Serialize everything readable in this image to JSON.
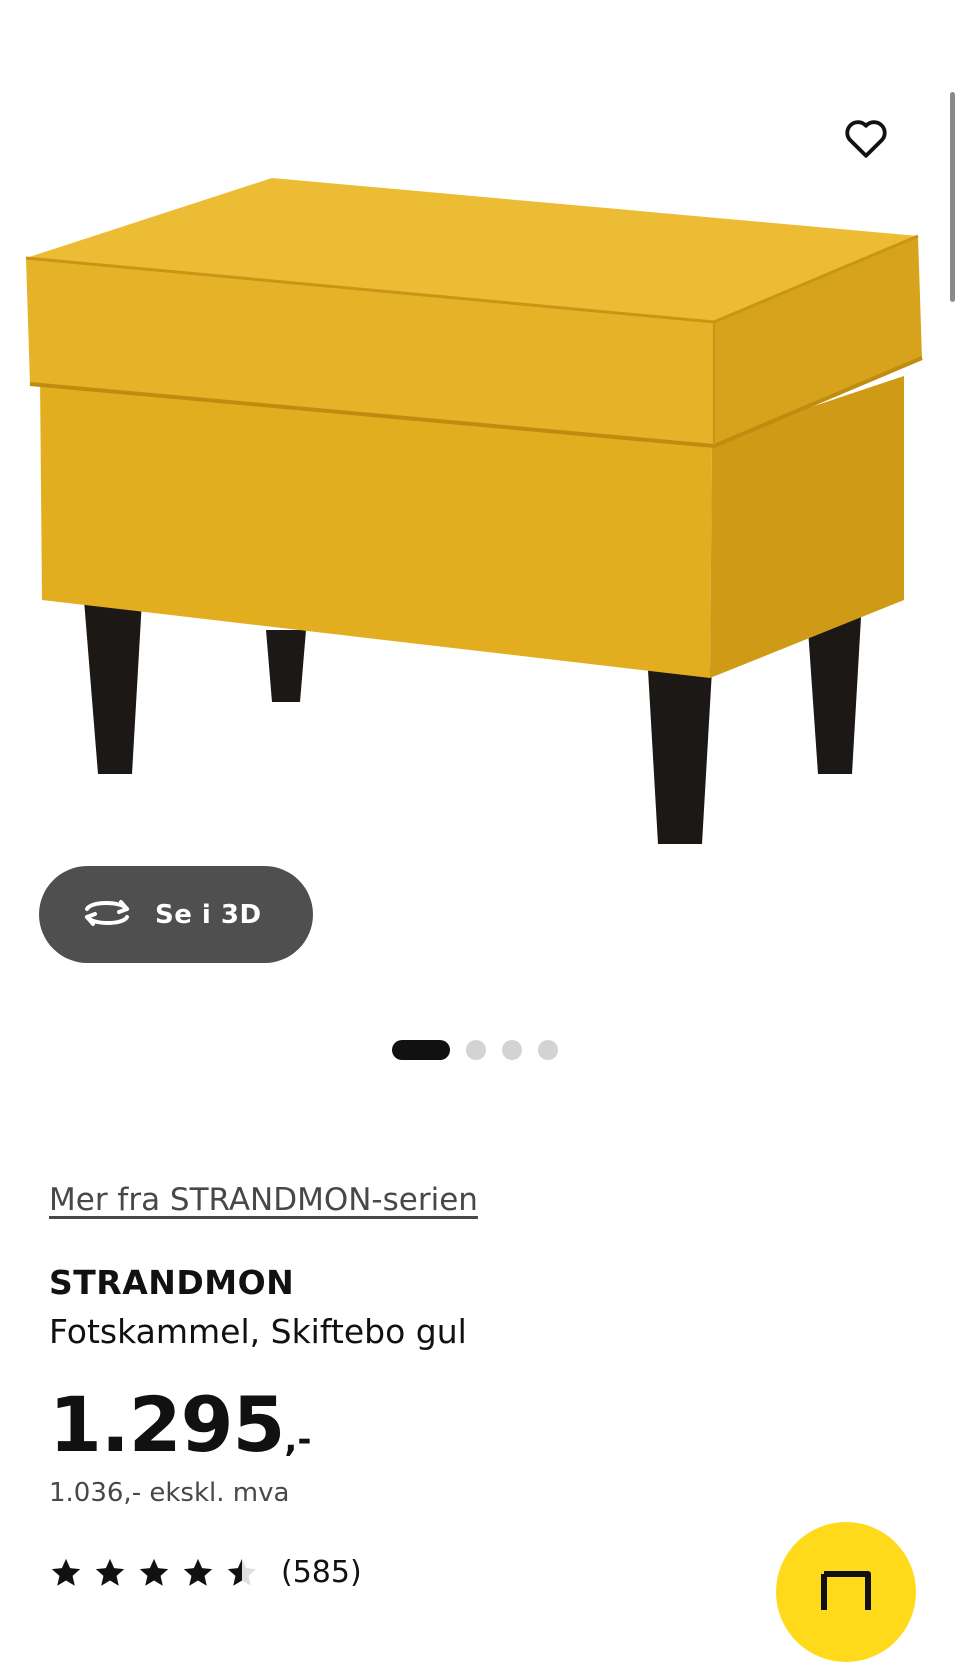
{
  "gallery": {
    "view_3d_label": "Se i 3D",
    "icons": {
      "favorite": "heart-outline-icon",
      "view_3d": "rotate-3d-icon"
    },
    "dots_total": 4,
    "active_dot": 1
  },
  "product": {
    "series_link": "Mer fra STRANDMON-serien",
    "name": "STRANDMON",
    "description": "Fotskammel, Skiftebo gul",
    "price": {
      "amount": "1.295",
      "suffix": ",-"
    },
    "price_excl_vat": "1.036,- ekskl. mva",
    "rating": {
      "value": 4.5,
      "max": 5,
      "reviews": "(585)"
    }
  },
  "colors": {
    "upholstery": "#e7b423",
    "legs": "#1c1816",
    "fab": "#ffda1a",
    "pill": "#4f4f4f"
  }
}
